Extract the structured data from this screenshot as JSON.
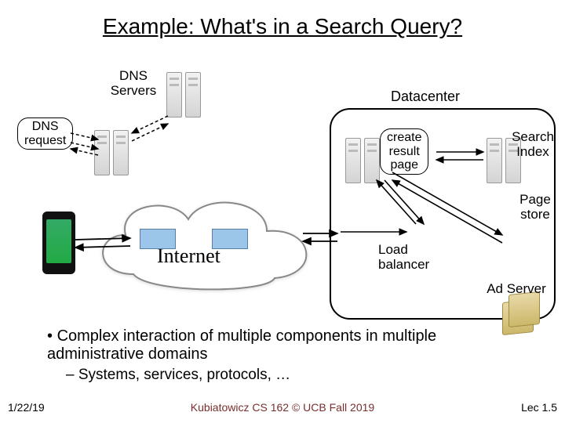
{
  "title": "Example: What's in a Search Query?",
  "labels": {
    "dns_servers": "DNS\nServers",
    "dns_request": "DNS\nrequest",
    "datacenter": "Datacenter",
    "create_result_page": "create\nresult\npage",
    "search_index": "Search\nIndex",
    "page_store": "Page\nstore",
    "load_balancer": "Load\nbalancer",
    "ad_server": "Ad Server",
    "internet": "Internet"
  },
  "bullets": {
    "b1": "Complex interaction of multiple components in multiple administrative domains",
    "b2": "Systems, services, protocols, …"
  },
  "footer": {
    "date": "1/22/19",
    "center": "Kubiatowicz CS 162 © UCB Fall 2019",
    "right": "Lec 1.5"
  }
}
